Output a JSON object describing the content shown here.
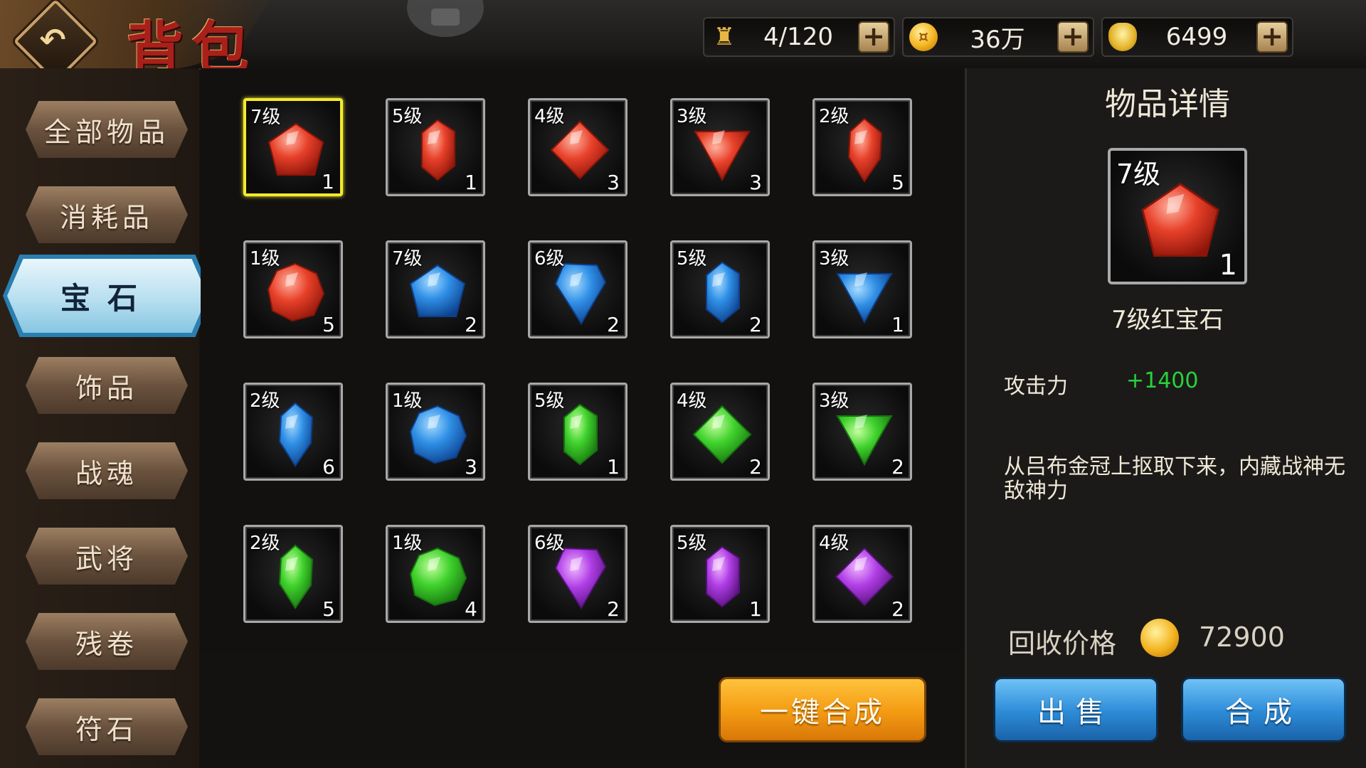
{
  "header": {
    "title": "背包",
    "back_icon": "↶",
    "resources": [
      {
        "name": "bag-capacity",
        "icon": "bag-icon",
        "value": "4/120"
      },
      {
        "name": "coins",
        "icon": "coin-icon",
        "value": "36万"
      },
      {
        "name": "ingots",
        "icon": "ingot-icon",
        "value": "6499"
      }
    ],
    "plus_label": "+"
  },
  "sidebar": {
    "items": [
      {
        "label": "全部物品",
        "active": false
      },
      {
        "label": "消耗品",
        "active": false
      },
      {
        "label": "宝石",
        "active": true
      },
      {
        "label": "饰品",
        "active": false
      },
      {
        "label": "战魂",
        "active": false
      },
      {
        "label": "武将",
        "active": false
      },
      {
        "label": "残卷",
        "active": false
      },
      {
        "label": "符石",
        "active": false
      }
    ]
  },
  "colors": {
    "red": "#e8412a",
    "blue": "#2f8fe6",
    "green": "#3fd12c",
    "purple": "#b03ee6",
    "selected_border": "#f3ea2c",
    "stat_green": "#27d23a"
  },
  "gems": [
    {
      "level": "7级",
      "count": "1",
      "color": "red",
      "shape": "pentagon",
      "selected": true
    },
    {
      "level": "5级",
      "count": "1",
      "color": "red",
      "shape": "hexagon",
      "selected": false
    },
    {
      "level": "4级",
      "count": "3",
      "color": "red",
      "shape": "diamond",
      "selected": false
    },
    {
      "level": "3级",
      "count": "3",
      "color": "red",
      "shape": "triangle",
      "selected": false
    },
    {
      "level": "2级",
      "count": "5",
      "color": "red",
      "shape": "drop",
      "selected": false
    },
    {
      "level": "1级",
      "count": "5",
      "color": "red",
      "shape": "round",
      "selected": false
    },
    {
      "level": "7级",
      "count": "2",
      "color": "blue",
      "shape": "pentagon",
      "selected": false
    },
    {
      "level": "6级",
      "count": "2",
      "color": "blue",
      "shape": "kite",
      "selected": false
    },
    {
      "level": "5级",
      "count": "2",
      "color": "blue",
      "shape": "hexagon",
      "selected": false
    },
    {
      "level": "3级",
      "count": "1",
      "color": "blue",
      "shape": "triangle",
      "selected": false
    },
    {
      "level": "2级",
      "count": "6",
      "color": "blue",
      "shape": "drop",
      "selected": false
    },
    {
      "level": "1级",
      "count": "3",
      "color": "blue",
      "shape": "round",
      "selected": false
    },
    {
      "level": "5级",
      "count": "1",
      "color": "green",
      "shape": "hexagon",
      "selected": false
    },
    {
      "level": "4级",
      "count": "2",
      "color": "green",
      "shape": "diamond",
      "selected": false
    },
    {
      "level": "3级",
      "count": "2",
      "color": "green",
      "shape": "triangle",
      "selected": false
    },
    {
      "level": "2级",
      "count": "5",
      "color": "green",
      "shape": "drop",
      "selected": false
    },
    {
      "level": "1级",
      "count": "4",
      "color": "green",
      "shape": "round",
      "selected": false
    },
    {
      "level": "6级",
      "count": "2",
      "color": "purple",
      "shape": "kite",
      "selected": false
    },
    {
      "level": "5级",
      "count": "1",
      "color": "purple",
      "shape": "hexagon",
      "selected": false
    },
    {
      "level": "4级",
      "count": "2",
      "color": "purple",
      "shape": "diamond",
      "selected": false
    }
  ],
  "one_key_button": "一键合成",
  "detail": {
    "title": "物品详情",
    "level": "7级",
    "count": "1",
    "color": "red",
    "shape": "pentagon",
    "item_name": "7级红宝石",
    "stat_label": "攻击力",
    "stat_value": "+1400",
    "description": "从吕布金冠上抠取下来，内藏战神无敌神力",
    "price_label": "回收价格",
    "price_value": "72900",
    "sell_button": "出售",
    "merge_button": "合成"
  }
}
